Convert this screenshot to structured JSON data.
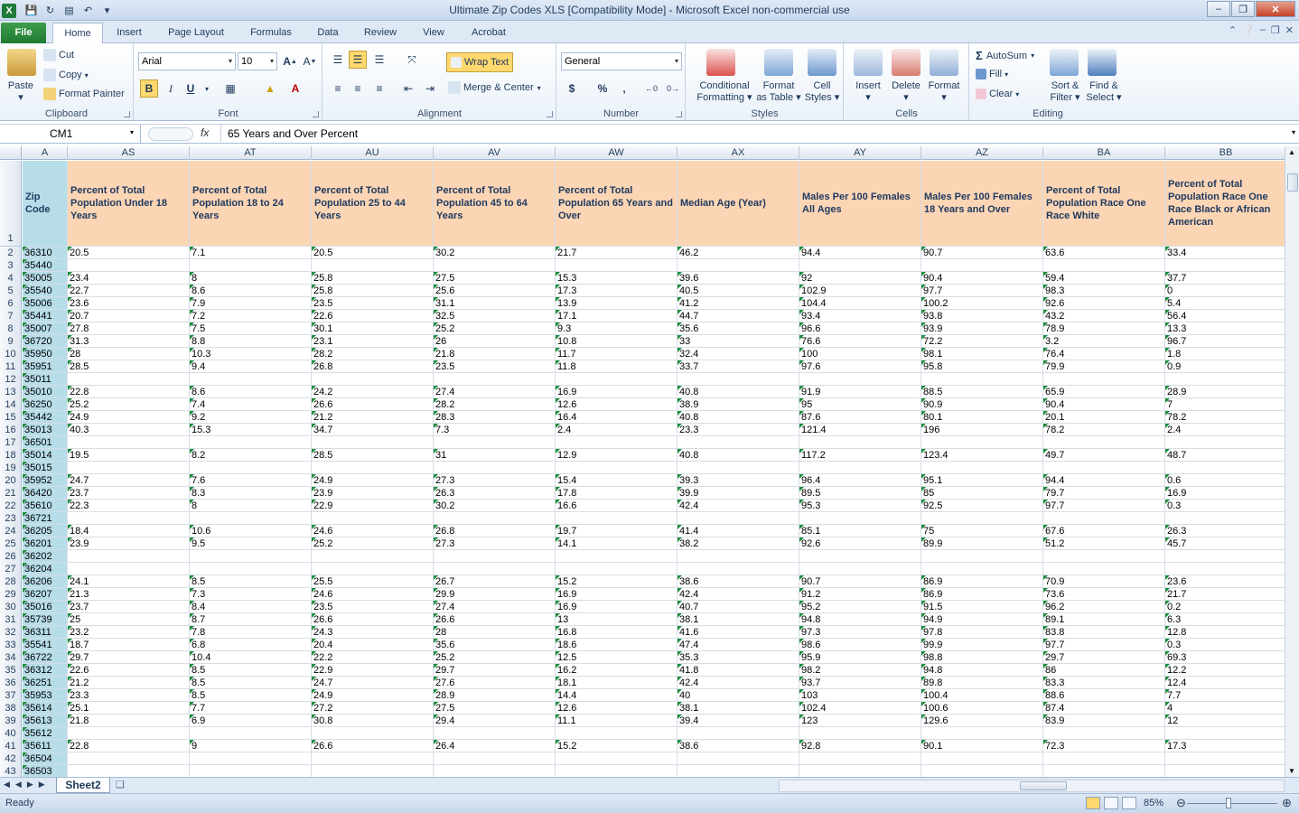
{
  "titlebar": {
    "title": "Ultimate Zip Codes XLS  [Compatibility Mode]  -  Microsoft Excel non-commercial use",
    "app_icon": "X"
  },
  "tabs": [
    {
      "label": "File"
    },
    {
      "label": "Home"
    },
    {
      "label": "Insert"
    },
    {
      "label": "Page Layout"
    },
    {
      "label": "Formulas"
    },
    {
      "label": "Data"
    },
    {
      "label": "Review"
    },
    {
      "label": "View"
    },
    {
      "label": "Acrobat"
    }
  ],
  "ribbon": {
    "clipboard": {
      "label": "Clipboard",
      "paste": "Paste",
      "cut": "Cut",
      "copy": "Copy",
      "format_painter": "Format Painter"
    },
    "font": {
      "label": "Font",
      "name": "Arial",
      "size": "10",
      "bold": "B",
      "italic": "I",
      "underline": "U"
    },
    "alignment": {
      "label": "Alignment",
      "wrap_text": "Wrap Text",
      "merge_center": "Merge & Center"
    },
    "number": {
      "label": "Number",
      "format": "General",
      "currency": "$",
      "percent": "%",
      "comma": ","
    },
    "styles": {
      "label": "Styles",
      "conditional": "Conditional",
      "formatting": "Formatting",
      "format_as": "Format",
      "as_table": "as Table",
      "cell": "Cell",
      "cell_styles": "Styles"
    },
    "cells": {
      "label": "Cells",
      "insert": "Insert",
      "delete": "Delete",
      "format": "Format"
    },
    "editing": {
      "label": "Editing",
      "autosum": "AutoSum",
      "fill": "Fill",
      "clear": "Clear",
      "sort": "Sort &",
      "filter": "Filter",
      "find": "Find &",
      "select": "Select"
    }
  },
  "formula_bar": {
    "name_box": "CM1",
    "fx": "fx",
    "content": "65 Years and Over Percent"
  },
  "columns": [
    {
      "letter": "A",
      "header": "Zip Code"
    },
    {
      "letter": "AS",
      "header": "Percent of Total Population Under 18 Years"
    },
    {
      "letter": "AT",
      "header": "Percent of Total Population 18 to 24 Years"
    },
    {
      "letter": "AU",
      "header": "Percent of Total Population 25 to 44 Years"
    },
    {
      "letter": "AV",
      "header": "Percent of Total Population 45 to 64 Years"
    },
    {
      "letter": "AW",
      "header": "Percent of Total Population 65 Years and Over"
    },
    {
      "letter": "AX",
      "header": "Median Age (Year)"
    },
    {
      "letter": "AY",
      "header": "Males Per 100 Females All Ages"
    },
    {
      "letter": "AZ",
      "header": "Males Per 100 Females 18 Years and Over"
    },
    {
      "letter": "BA",
      "header": "Percent of Total Population Race One Race White"
    },
    {
      "letter": "BB",
      "header": "Percent of Total Population Race One Race Black or African American"
    }
  ],
  "rows": [
    [
      "36310",
      "20.5",
      "7.1",
      "20.5",
      "30.2",
      "21.7",
      "46.2",
      "94.4",
      "90.7",
      "63.6",
      "33.4"
    ],
    [
      "35440",
      "",
      "",
      "",
      "",
      "",
      "",
      "",
      "",
      "",
      ""
    ],
    [
      "35005",
      "23.4",
      "8",
      "25.8",
      "27.5",
      "15.3",
      "39.6",
      "92",
      "90.4",
      "59.4",
      "37.7"
    ],
    [
      "35540",
      "22.7",
      "8.6",
      "25.8",
      "25.6",
      "17.3",
      "40.5",
      "102.9",
      "97.7",
      "98.3",
      "0"
    ],
    [
      "35006",
      "23.6",
      "7.9",
      "23.5",
      "31.1",
      "13.9",
      "41.2",
      "104.4",
      "100.2",
      "92.6",
      "5.4"
    ],
    [
      "35441",
      "20.7",
      "7.2",
      "22.6",
      "32.5",
      "17.1",
      "44.7",
      "93.4",
      "93.8",
      "43.2",
      "56.4"
    ],
    [
      "35007",
      "27.8",
      "7.5",
      "30.1",
      "25.2",
      "9.3",
      "35.6",
      "96.6",
      "93.9",
      "78.9",
      "13.3"
    ],
    [
      "36720",
      "31.3",
      "8.8",
      "23.1",
      "26",
      "10.8",
      "33",
      "76.6",
      "72.2",
      "3.2",
      "96.7"
    ],
    [
      "35950",
      "28",
      "10.3",
      "28.2",
      "21.8",
      "11.7",
      "32.4",
      "100",
      "98.1",
      "76.4",
      "1.8"
    ],
    [
      "35951",
      "28.5",
      "9.4",
      "26.8",
      "23.5",
      "11.8",
      "33.7",
      "97.6",
      "95.8",
      "79.9",
      "0.9"
    ],
    [
      "35011",
      "",
      "",
      "",
      "",
      "",
      "",
      "",
      "",
      "",
      ""
    ],
    [
      "35010",
      "22.8",
      "8.6",
      "24.2",
      "27.4",
      "16.9",
      "40.8",
      "91.9",
      "88.5",
      "65.9",
      "28.9"
    ],
    [
      "36250",
      "25.2",
      "7.4",
      "26.6",
      "28.2",
      "12.6",
      "38.9",
      "95",
      "90.9",
      "90.4",
      "7"
    ],
    [
      "35442",
      "24.9",
      "9.2",
      "21.2",
      "28.3",
      "16.4",
      "40.8",
      "87.6",
      "80.1",
      "20.1",
      "78.2"
    ],
    [
      "35013",
      "40.3",
      "15.3",
      "34.7",
      "7.3",
      "2.4",
      "23.3",
      "121.4",
      "196",
      "78.2",
      "2.4"
    ],
    [
      "36501",
      "",
      "",
      "",
      "",
      "",
      "",
      "",
      "",
      "",
      ""
    ],
    [
      "35014",
      "19.5",
      "8.2",
      "28.5",
      "31",
      "12.9",
      "40.8",
      "117.2",
      "123.4",
      "49.7",
      "48.7"
    ],
    [
      "35015",
      "",
      "",
      "",
      "",
      "",
      "",
      "",
      "",
      "",
      ""
    ],
    [
      "35952",
      "24.7",
      "7.6",
      "24.9",
      "27.3",
      "15.4",
      "39.3",
      "96.4",
      "95.1",
      "94.4",
      "0.6"
    ],
    [
      "36420",
      "23.7",
      "8.3",
      "23.9",
      "26.3",
      "17.8",
      "39.9",
      "89.5",
      "85",
      "79.7",
      "16.9"
    ],
    [
      "35610",
      "22.3",
      "8",
      "22.9",
      "30.2",
      "16.6",
      "42.4",
      "95.3",
      "92.5",
      "97.7",
      "0.3"
    ],
    [
      "36721",
      "",
      "",
      "",
      "",
      "",
      "",
      "",
      "",
      "",
      ""
    ],
    [
      "36205",
      "18.4",
      "10.6",
      "24.6",
      "26.8",
      "19.7",
      "41.4",
      "85.1",
      "75",
      "67.6",
      "26.3"
    ],
    [
      "36201",
      "23.9",
      "9.5",
      "25.2",
      "27.3",
      "14.1",
      "38.2",
      "92.6",
      "89.9",
      "51.2",
      "45.7"
    ],
    [
      "36202",
      "",
      "",
      "",
      "",
      "",
      "",
      "",
      "",
      "",
      ""
    ],
    [
      "36204",
      "",
      "",
      "",
      "",
      "",
      "",
      "",
      "",
      "",
      ""
    ],
    [
      "36206",
      "24.1",
      "8.5",
      "25.5",
      "26.7",
      "15.2",
      "38.6",
      "90.7",
      "86.9",
      "70.9",
      "23.6"
    ],
    [
      "36207",
      "21.3",
      "7.3",
      "24.6",
      "29.9",
      "16.9",
      "42.4",
      "91.2",
      "86.9",
      "73.6",
      "21.7"
    ],
    [
      "35016",
      "23.7",
      "8.4",
      "23.5",
      "27.4",
      "16.9",
      "40.7",
      "95.2",
      "91.5",
      "96.2",
      "0.2"
    ],
    [
      "35739",
      "25",
      "8.7",
      "26.6",
      "26.6",
      "13",
      "38.1",
      "94.8",
      "94.9",
      "89.1",
      "6.3"
    ],
    [
      "36311",
      "23.2",
      "7.8",
      "24.3",
      "28",
      "16.8",
      "41.6",
      "97.3",
      "97.8",
      "83.8",
      "12.8"
    ],
    [
      "35541",
      "18.7",
      "6.8",
      "20.4",
      "35.6",
      "18.6",
      "47.4",
      "98.6",
      "99.9",
      "97.7",
      "0.3"
    ],
    [
      "36722",
      "29.7",
      "10.4",
      "22.2",
      "25.2",
      "12.5",
      "35.3",
      "95.9",
      "98.8",
      "29.7",
      "69.3"
    ],
    [
      "36312",
      "22.6",
      "8.5",
      "22.9",
      "29.7",
      "16.2",
      "41.8",
      "98.2",
      "94.8",
      "86",
      "12.2"
    ],
    [
      "36251",
      "21.2",
      "8.5",
      "24.7",
      "27.6",
      "18.1",
      "42.4",
      "93.7",
      "89.8",
      "83.3",
      "12.4"
    ],
    [
      "35953",
      "23.3",
      "8.5",
      "24.9",
      "28.9",
      "14.4",
      "40",
      "103",
      "100.4",
      "88.6",
      "7.7"
    ],
    [
      "35614",
      "25.1",
      "7.7",
      "27.2",
      "27.5",
      "12.6",
      "38.1",
      "102.4",
      "100.6",
      "87.4",
      "4"
    ],
    [
      "35613",
      "21.8",
      "6.9",
      "30.8",
      "29.4",
      "11.1",
      "39.4",
      "123",
      "129.6",
      "83.9",
      "12"
    ],
    [
      "35612",
      "",
      "",
      "",
      "",
      "",
      "",
      "",
      "",
      "",
      ""
    ],
    [
      "35611",
      "22.8",
      "9",
      "26.6",
      "26.4",
      "15.2",
      "38.6",
      "92.8",
      "90.1",
      "72.3",
      "17.3"
    ],
    [
      "36504",
      "",
      "",
      "",
      "",
      "",
      "",
      "",
      "",
      "",
      ""
    ],
    [
      "36503",
      "",
      "",
      "",
      "",
      "",
      "",
      "",
      "",
      "",
      ""
    ]
  ],
  "sheet": {
    "tab": "Sheet2"
  },
  "statusbar": {
    "status": "Ready",
    "zoom": "85%"
  },
  "colors": {
    "header_fill": "#fcd5b4",
    "zip_fill": "#b7dde8",
    "error_triangle": "#1c8d3a"
  }
}
